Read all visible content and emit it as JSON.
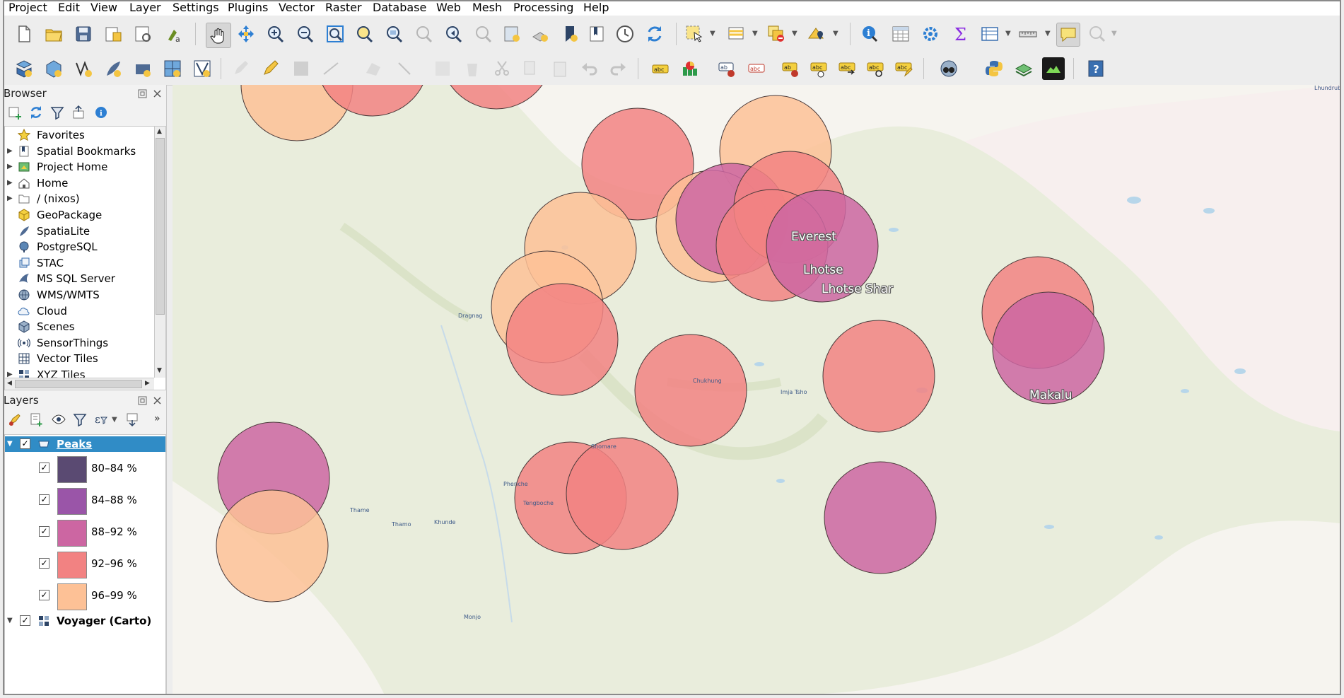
{
  "menu": [
    "Project",
    "Edit",
    "View",
    "Layer",
    "Settings",
    "Plugins",
    "Vector",
    "Raster",
    "Database",
    "Web",
    "Mesh",
    "Processing",
    "Help"
  ],
  "browser": {
    "title": "Browser",
    "items": [
      {
        "label": "Favorites",
        "icon": "star-icon",
        "expandable": false
      },
      {
        "label": "Spatial Bookmarks",
        "icon": "bookmark-icon",
        "expandable": true
      },
      {
        "label": "Project Home",
        "icon": "project-home-icon",
        "expandable": true
      },
      {
        "label": "Home",
        "icon": "home-icon",
        "expandable": true
      },
      {
        "label": "/ (nixos)",
        "icon": "folder-icon",
        "expandable": true
      },
      {
        "label": "GeoPackage",
        "icon": "geopackage-icon",
        "expandable": false
      },
      {
        "label": "SpatiaLite",
        "icon": "spatialite-icon",
        "expandable": false
      },
      {
        "label": "PostgreSQL",
        "icon": "postgresql-icon",
        "expandable": false
      },
      {
        "label": "STAC",
        "icon": "stac-icon",
        "expandable": false
      },
      {
        "label": "MS SQL Server",
        "icon": "mssql-icon",
        "expandable": false
      },
      {
        "label": "WMS/WMTS",
        "icon": "globe-icon",
        "expandable": false
      },
      {
        "label": "Cloud",
        "icon": "cloud-icon",
        "expandable": false
      },
      {
        "label": "Scenes",
        "icon": "cube-icon",
        "expandable": false
      },
      {
        "label": "SensorThings",
        "icon": "sensor-icon",
        "expandable": false
      },
      {
        "label": "Vector Tiles",
        "icon": "grid-icon",
        "expandable": false
      },
      {
        "label": "XYZ Tiles",
        "icon": "tiles-icon",
        "expandable": true
      }
    ]
  },
  "layers": {
    "title": "Layers",
    "peaks_layer": "Peaks",
    "classes": [
      {
        "label": "80–84 %",
        "color": "#5a4a72"
      },
      {
        "label": "84–88 %",
        "color": "#9a55a8"
      },
      {
        "label": "88–92 %",
        "color": "#cc66a2"
      },
      {
        "label": "92–96 %",
        "color": "#f28282"
      },
      {
        "label": "96–99 %",
        "color": "#fdc196"
      }
    ],
    "basemap_layer": "Voyager (Carto)"
  },
  "map": {
    "labels": [
      "Everest",
      "Lhotse",
      "Lhotse Shar",
      "Makalu"
    ],
    "towns": [
      "Dragnag",
      "Chukhung",
      "Imja Tsho",
      "Shomare",
      "Pheriche",
      "Tengboche",
      "Thame",
      "Thamo",
      "Khunde",
      "Monjo",
      "Lhundrub"
    ]
  },
  "colors": {
    "selected_row": "#308cc6",
    "map_land": "#f6f4ef",
    "map_green": "#e7ecd9"
  }
}
